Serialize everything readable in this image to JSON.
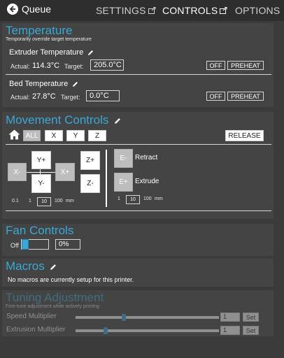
{
  "nav": {
    "back_label": "Queue",
    "settings": "SETTINGS",
    "controls": "CONTROLS",
    "options": "OPTIONS"
  },
  "temperature": {
    "title": "Temperature",
    "subtitle": "Temporarily override target temperature",
    "extruder": {
      "name": "Extruder Temperature",
      "actual_label": "Actual:",
      "actual": "114.3°C",
      "target_label": "Target:",
      "target": "205.0°C",
      "off": "OFF",
      "preheat": "PREHEAT"
    },
    "bed": {
      "name": "Bed Temperature",
      "actual_label": "Actual:",
      "actual": "27.8°C",
      "target_label": "Target:",
      "target": "0.0°C",
      "off": "OFF",
      "preheat": "PREHEAT"
    }
  },
  "movement": {
    "title": "Movement Controls",
    "home_all": "ALL",
    "home_x": "X",
    "home_y": "Y",
    "home_z": "Z",
    "release": "RELEASE",
    "x_minus": "X-",
    "x_plus": "X+",
    "y_plus": "Y+",
    "y_minus": "Y-",
    "z_plus": "Z+",
    "z_minus": "Z-",
    "e_minus": "E-",
    "e_plus": "E+",
    "retract": "Retract",
    "extrude": "Extrude",
    "xyz_steps": [
      "0.1",
      "1",
      "10",
      "100"
    ],
    "xyz_selected": "10",
    "e_steps": [
      "1",
      "10",
      "100"
    ],
    "e_selected": "10",
    "unit": "mm"
  },
  "fan": {
    "title": "Fan Controls",
    "state": "Off",
    "value": "0%",
    "level": 0
  },
  "macros": {
    "title": "Macros",
    "empty": "No macros are currently setup for this printer."
  },
  "tuning": {
    "title": "Tuning Adjustment",
    "subtitle": "Fine-tune adjustment while actively printing",
    "speed_label": "Speed Multiplier",
    "speed_value": "1",
    "speed_set": "Set",
    "speed_level": 0.33,
    "extrusion_label": "Extrusion Multiplier",
    "extrusion_value": "1",
    "extrusion_set": "Set",
    "extrusion_level": 0.2
  }
}
